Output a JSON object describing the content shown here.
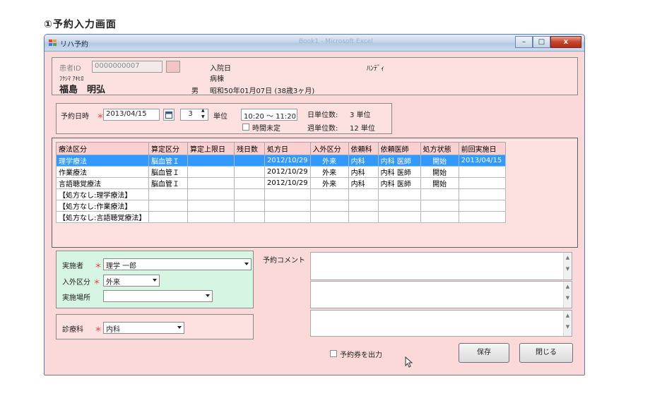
{
  "caption": "①予約入力画面",
  "window": {
    "title": "リハ予約",
    "ghost_title": "Book1 - Microsoft Excel",
    "min_glyph": "–",
    "max_glyph": "□",
    "close_glyph": "x"
  },
  "patient": {
    "id_label": "患者ID",
    "id_value": "0000000007",
    "kana": "ﾌｸｼﾏ ｱｷﾋﾛ",
    "name": "福島　明弘",
    "sex": "男",
    "admit_label": "入院日",
    "ward_label": "病棟",
    "birth": "昭和50年01月07日 (38歳3ヶ月)",
    "handy": "ﾊﾝﾃﾞｨ"
  },
  "schedule": {
    "date_label": "予約日時",
    "required_mark": "＊",
    "date_value": "2013/04/15",
    "units_value": "3",
    "units_label": "単位",
    "time_value": "10:20 ～ 11:20",
    "undecided_label": "時間未定",
    "day_units_label": "日単位数:",
    "day_units_value": "3 単位",
    "week_units_label": "週単位数:",
    "week_units_value": "12 単位"
  },
  "table": {
    "headers": [
      "療法区分",
      "算定区分",
      "算定上限日",
      "残日数",
      "処方日",
      "入外区分",
      "依頼科",
      "依頼医師",
      "処方状態",
      "前回実施日"
    ],
    "rows": [
      [
        "理学療法",
        "脳血管Ｉ",
        "",
        "",
        "2012/10/29",
        "外来",
        "内科",
        "内科 医師",
        "開始",
        "2013/04/15"
      ],
      [
        "作業療法",
        "脳血管Ｉ",
        "",
        "",
        "2012/10/29",
        "外来",
        "内科",
        "内科 医師",
        "開始",
        ""
      ],
      [
        "言語聴覚療法",
        "脳血管Ｉ",
        "",
        "",
        "2012/10/29",
        "外来",
        "内科",
        "内科 医師",
        "開始",
        ""
      ],
      [
        "【処方なし:理学療法】",
        "",
        "",
        "",
        "",
        "",
        "",
        "",
        "",
        ""
      ],
      [
        "【処方なし:作業療法】",
        "",
        "",
        "",
        "",
        "",
        "",
        "",
        "",
        ""
      ],
      [
        "【処方なし:言語聴覚療法】",
        "",
        "",
        "",
        "",
        "",
        "",
        "",
        "",
        ""
      ]
    ]
  },
  "form": {
    "performer_label": "実施者",
    "performer_value": "理学 一郎",
    "inout_label": "入外区分",
    "inout_value": "外来",
    "place_label": "実施場所",
    "place_value": "",
    "dept_label": "診療科",
    "dept_value": "内科",
    "comment_label": "予約コメント",
    "scroll_up": "▲",
    "scroll_down": "▼"
  },
  "footer": {
    "print_label": "予約券を出力",
    "save_label": "保存",
    "close_label": "閉じる"
  },
  "colors": {
    "window_bg": "#fbd9d9",
    "selection": "#3399ff",
    "required": "#e03030",
    "form_bg": "#d6f5e2"
  }
}
